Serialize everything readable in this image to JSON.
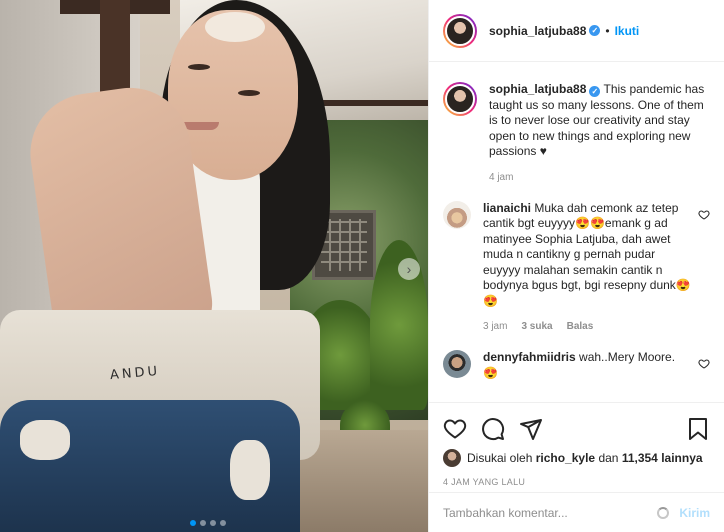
{
  "post": {
    "username": "sophia_latjuba88",
    "verified": true,
    "follow_label": "Ikuti",
    "apron_text": "ANDU",
    "image_page": {
      "current": 1,
      "total": 4
    }
  },
  "caption": {
    "username": "sophia_latjuba88",
    "text": "This pandemic has taught us so many lessons. One of them is to never lose our creativity and stay open to new things and exploring new passions ♥",
    "time": "4 jam"
  },
  "comments": [
    {
      "username": "lianaichi",
      "text": "Muka dah cemonk az tetep cantik bgt euyyyy😍😍emank g ad matinyee Sophia Latjuba, dah awet muda n cantikny g pernah pudar euyyyy malahan semakin cantik n bodynya bgus bgt, bgi resepny dunk😍😍",
      "time": "3 jam",
      "likes": "3 suka",
      "reply_label": "Balas"
    },
    {
      "username": "dennyfahmiidris",
      "text": "wah..Mery Moore. 😍",
      "time": "",
      "likes": "",
      "reply_label": ""
    }
  ],
  "actions": {
    "icons": [
      "heart-icon",
      "comment-icon",
      "share-icon",
      "bookmark-icon"
    ],
    "liked_by_prefix": "Disukai oleh",
    "liked_by_user": "richo_kyle",
    "liked_by_and": "dan",
    "liked_count": "11,354 lainnya",
    "timestamp": "4 JAM YANG LALU"
  },
  "add_comment": {
    "placeholder": "Tambahkan komentar...",
    "post_label": "Kirim"
  },
  "colors": {
    "accent": "#0095f6",
    "verified": "#3897f0",
    "muted": "#8e8e8e",
    "text": "#262626"
  }
}
